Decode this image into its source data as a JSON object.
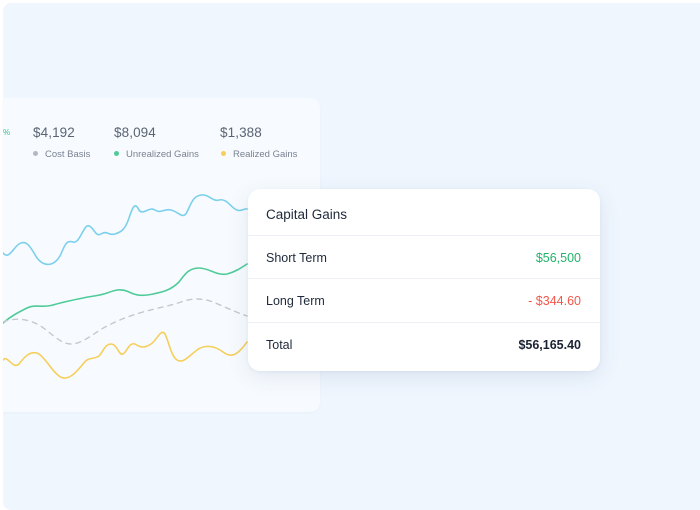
{
  "colors": {
    "cost_basis": "#b3b8c2",
    "unrealized": "#4fcb98",
    "realized": "#f6cf5a",
    "primary_line": "#7cd0ec",
    "positive": "#21b36b",
    "negative": "#f0574a"
  },
  "stats": [
    {
      "value": "$4,192",
      "label": "Cost Basis"
    },
    {
      "value": "$8,094",
      "label": "Unrealized Gains"
    },
    {
      "value": "$1,388",
      "label": "Realized Gains"
    }
  ],
  "edge_mark": "%",
  "capital_gains": {
    "title": "Capital Gains",
    "rows": [
      {
        "label": "Short Term",
        "value": "$56,500"
      },
      {
        "label": "Long Term",
        "value": "- $344.60"
      },
      {
        "label": "Total",
        "value": "$56,165.40"
      }
    ]
  }
}
